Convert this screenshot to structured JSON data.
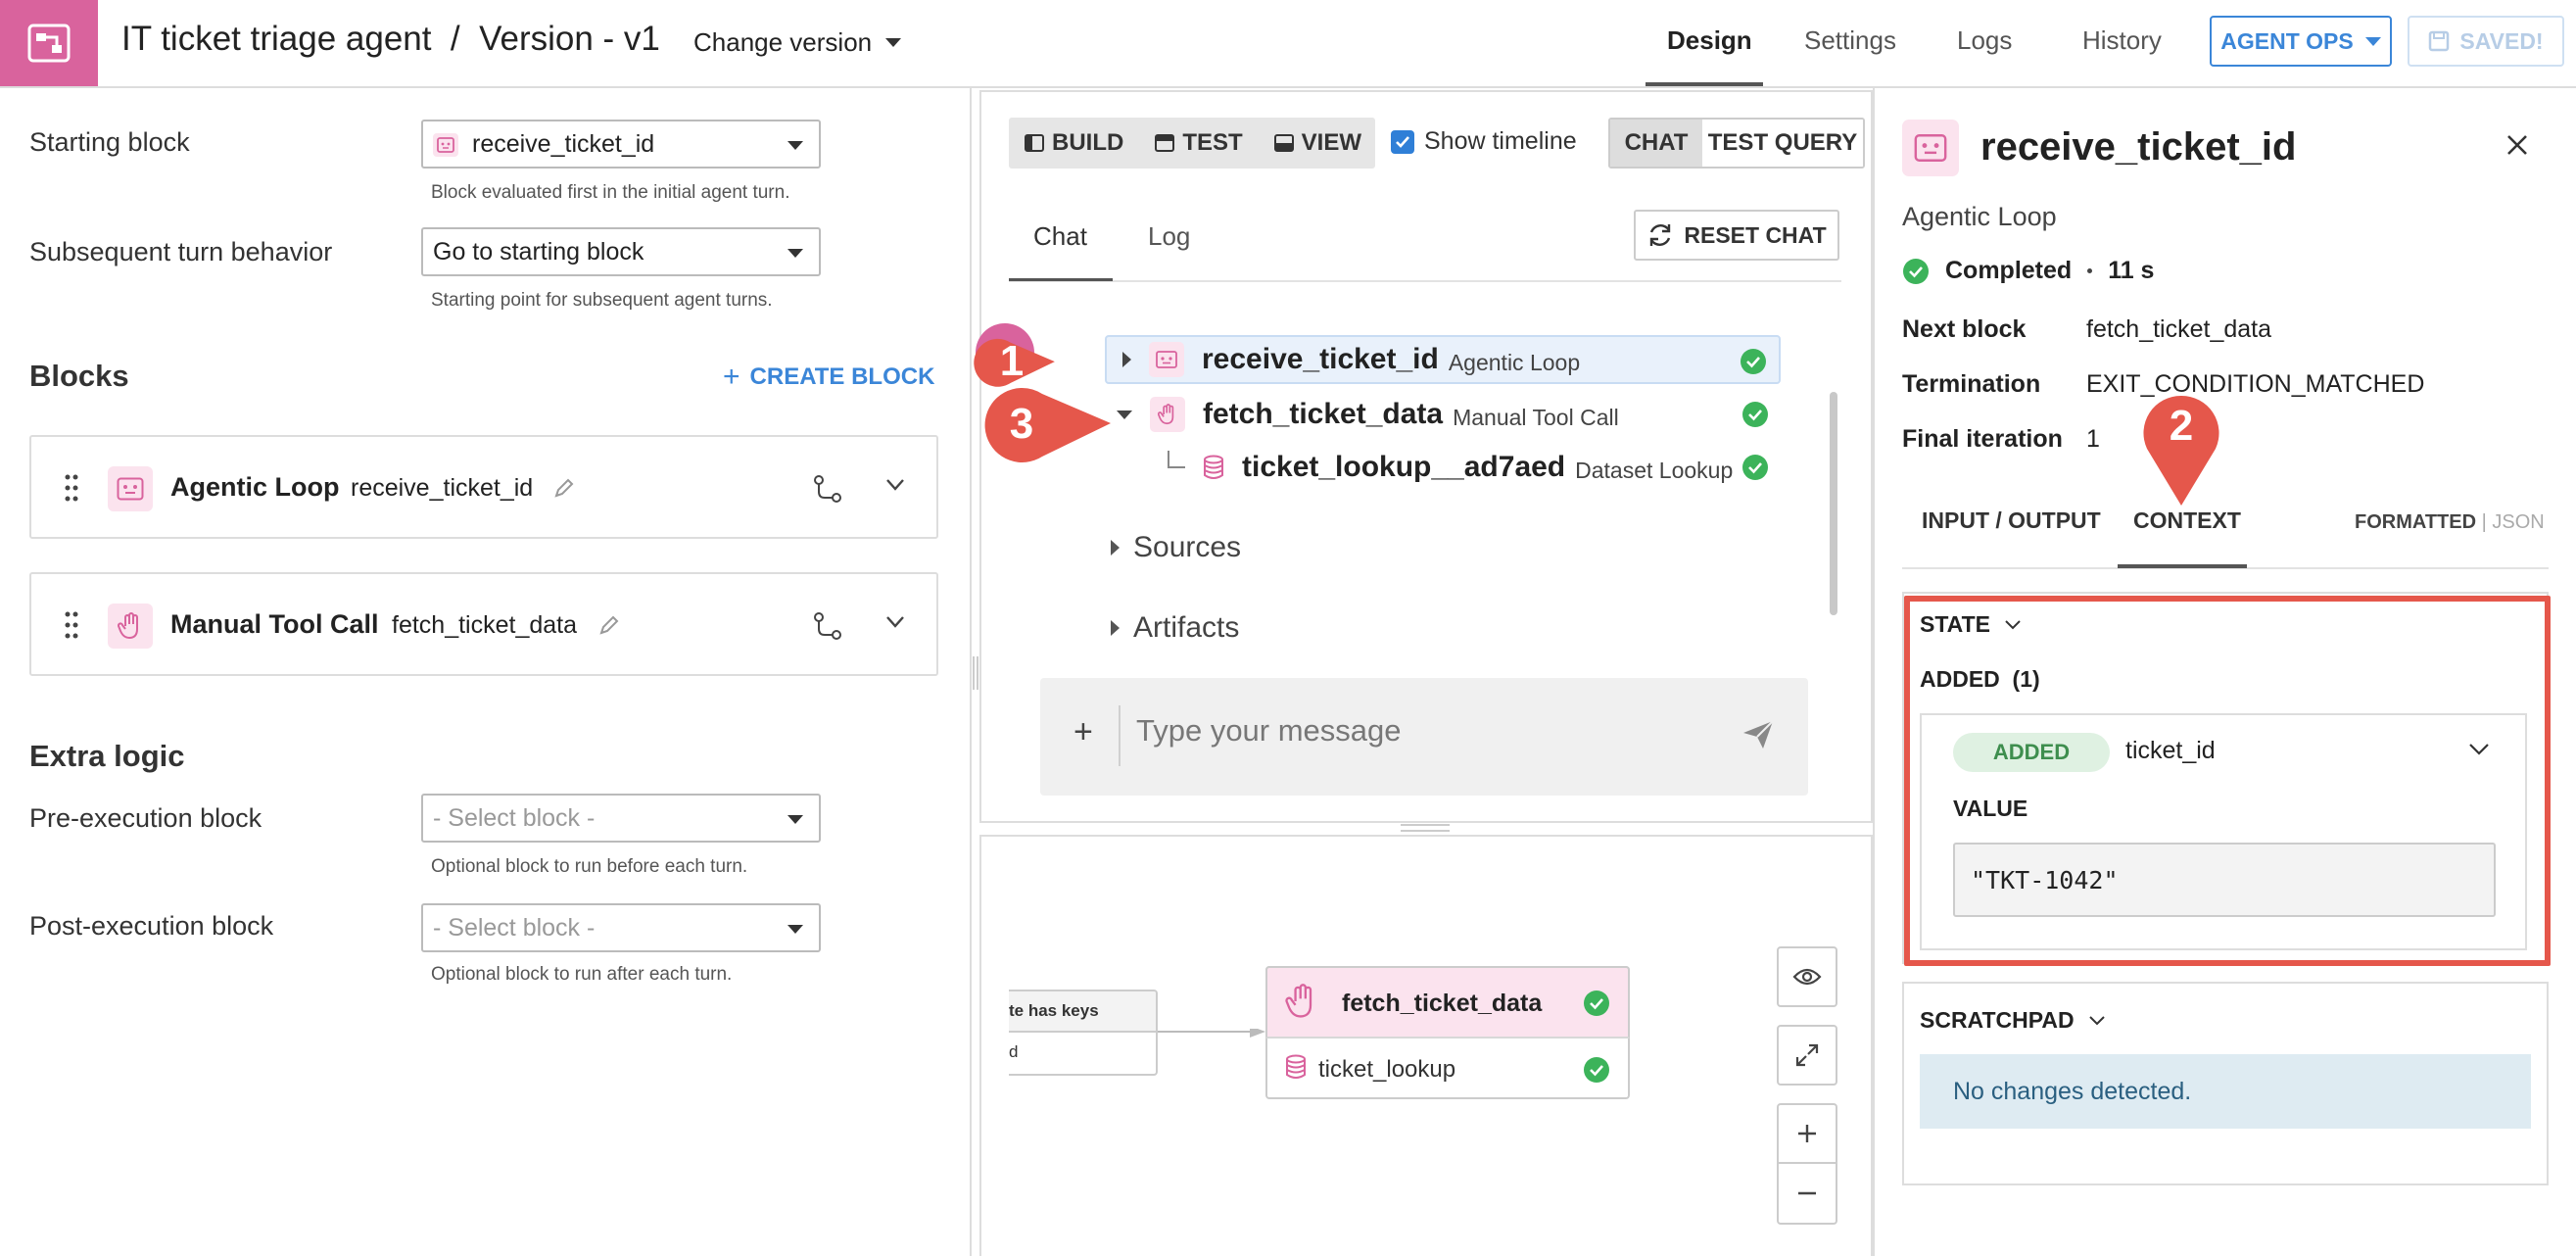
{
  "header": {
    "title": "IT ticket triage agent  /  Version - v1",
    "change_version": "Change version",
    "tabs": [
      {
        "label": "Design",
        "active": true
      },
      {
        "label": "Settings"
      },
      {
        "label": "Logs"
      },
      {
        "label": "History"
      }
    ],
    "agent_ops": "AGENT OPS",
    "saved": "SAVED!"
  },
  "left": {
    "starting_block": {
      "label": "Starting block",
      "value": "receive_ticket_id",
      "hint": "Block evaluated first in the initial agent turn."
    },
    "subsequent": {
      "label": "Subsequent turn behavior",
      "value": "Go to starting block",
      "hint": "Starting point for subsequent agent turns."
    },
    "blocks_title": "Blocks",
    "create_block": "CREATE BLOCK",
    "blocks": [
      {
        "type": "Agentic Loop",
        "name": "receive_ticket_id"
      },
      {
        "type": "Manual Tool Call",
        "name": "fetch_ticket_data"
      }
    ],
    "extra_logic_title": "Extra logic",
    "pre_exec": {
      "label": "Pre-execution block",
      "value": "- Select block -",
      "hint": "Optional block to run before each turn."
    },
    "post_exec": {
      "label": "Post-execution block",
      "value": "- Select block -",
      "hint": "Optional block to run after each turn."
    }
  },
  "chat": {
    "modes": [
      "BUILD",
      "TEST",
      "VIEW"
    ],
    "show_timeline": "Show timeline",
    "chat_opt": "CHAT",
    "test_query_opt": "TEST QUERY",
    "subtabs": [
      "Chat",
      "Log"
    ],
    "reset_chat": "RESET CHAT",
    "timeline": [
      {
        "name": "receive_ticket_id",
        "type": "Agentic Loop"
      },
      {
        "name": "fetch_ticket_data",
        "type": "Manual Tool Call"
      },
      {
        "name": "ticket_lookup__ad7aed",
        "type": "Dataset Lookup"
      }
    ],
    "sources": "Sources",
    "artifacts": "Artifacts",
    "composer_placeholder": "Type your message",
    "composer_plus": "+"
  },
  "graph": {
    "prev_node_title": "te has keys",
    "prev_node_body": "d",
    "node_title": "fetch_ticket_data",
    "node_sub": "ticket_lookup"
  },
  "right": {
    "title": "receive_ticket_id",
    "type": "Agentic Loop",
    "status": "Completed",
    "duration": "11 s",
    "details": [
      {
        "key": "Next block",
        "value": "fetch_ticket_data"
      },
      {
        "key": "Termination",
        "value": "EXIT_CONDITION_MATCHED"
      },
      {
        "key": "Final iteration",
        "value": "1"
      }
    ],
    "tabs": [
      "INPUT / OUTPUT",
      "CONTEXT"
    ],
    "format_formatted": "FORMATTED",
    "format_sep": " | ",
    "format_json": "JSON",
    "state_title": "STATE",
    "added_label": "ADDED  (1)",
    "added_badge": "ADDED",
    "state_key": "ticket_id",
    "value_label": "VALUE",
    "value": "\"TKT-1042\"",
    "scratchpad_title": "SCRATCHPAD",
    "scratchpad_msg": "No changes detected."
  },
  "markers": [
    "1",
    "2",
    "3"
  ],
  "colors": {
    "brand": "#d9639d",
    "accent": "#3b86d8",
    "success": "#3cb35a",
    "callout": "#e5574b",
    "block_tint": "#fbe3ee"
  }
}
